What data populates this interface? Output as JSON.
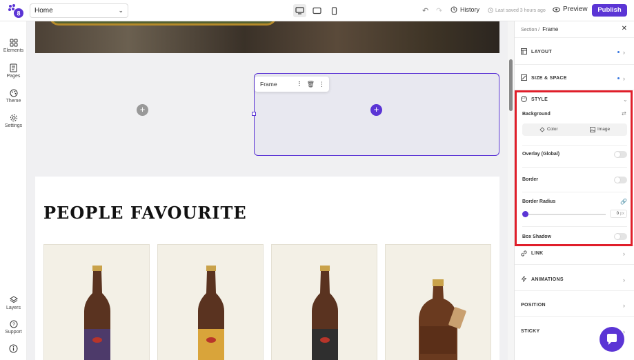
{
  "topbar": {
    "page_select": "Home",
    "history_label": "History",
    "saved_label": "Last saved 3 hours ago",
    "preview_label": "Preview",
    "publish_label": "Publish"
  },
  "leftbar": {
    "items": [
      {
        "label": "Elements",
        "icon": "grid-icon"
      },
      {
        "label": "Pages",
        "icon": "page-icon"
      },
      {
        "label": "Theme",
        "icon": "palette-icon"
      },
      {
        "label": "Settings",
        "icon": "gear-icon"
      }
    ],
    "bottom": [
      {
        "label": "Layers",
        "icon": "layers-icon"
      },
      {
        "label": "Support",
        "icon": "help-icon"
      }
    ]
  },
  "canvas": {
    "frame_toolbar_label": "Frame",
    "section_title": "PEOPLE FAVOURITE"
  },
  "panel": {
    "breadcrumb_parent": "Section",
    "breadcrumb_current": "Frame",
    "sections": {
      "layout": "LAYOUT",
      "size_space": "SIZE & SPACE",
      "style": "STYLE",
      "link": "LINK",
      "animations": "ANIMATIONS",
      "position": "POSITION",
      "sticky": "STICKY"
    },
    "style": {
      "background_label": "Background",
      "tab_color": "Color",
      "tab_image": "Image",
      "overlay_label": "Overlay (Global)",
      "border_label": "Border",
      "border_radius_label": "Border Radius",
      "border_radius_value": "0",
      "border_radius_unit": "px",
      "box_shadow_label": "Box Shadow"
    }
  },
  "colors": {
    "accent": "#5b35d5",
    "highlight": "#e01e2a"
  }
}
